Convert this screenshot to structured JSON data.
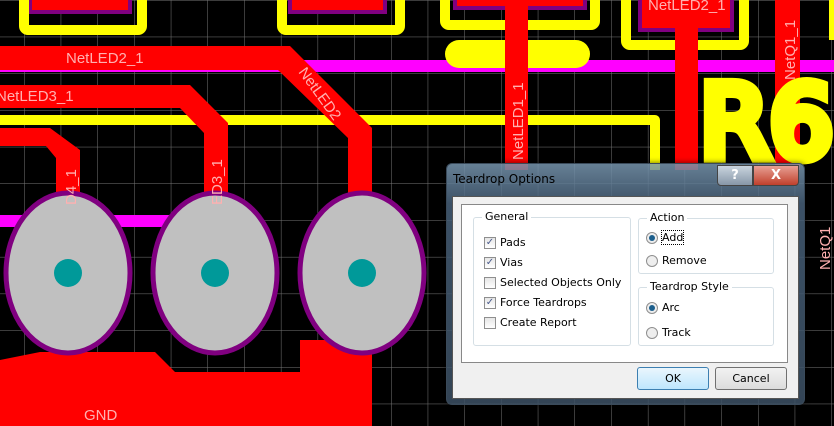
{
  "pcb": {
    "net_labels": [
      "NetLED2_1",
      "NetLED3_1",
      "NetLED2",
      "D4_1",
      "ED3_1",
      "NetLED1_1",
      "NetLED2_1",
      "NetQ1_1",
      "NetQ1"
    ],
    "designator": "R6",
    "gnd_label": "GND"
  },
  "colors": {
    "top_layer": "#ff0000",
    "overlay": "#ffff00",
    "bottom": "#ff00ff",
    "pad": "#c0c0c0",
    "hole": "#009999"
  },
  "dialog": {
    "title": "Teardrop Options",
    "help": "?",
    "close": "X",
    "general": {
      "label": "General",
      "items": [
        {
          "label": "Pads",
          "checked": true
        },
        {
          "label": "Vias",
          "checked": true
        },
        {
          "label": "Selected Objects Only",
          "checked": false
        },
        {
          "label": "Force Teardrops",
          "checked": true
        },
        {
          "label": "Create Report",
          "checked": false
        }
      ]
    },
    "action": {
      "label": "Action",
      "options": [
        {
          "label": "Add",
          "selected": true
        },
        {
          "label": "Remove",
          "selected": false
        }
      ]
    },
    "style": {
      "label": "Teardrop Style",
      "options": [
        {
          "label": "Arc",
          "selected": true
        },
        {
          "label": "Track",
          "selected": false
        }
      ]
    },
    "ok": "OK",
    "cancel": "Cancel"
  }
}
